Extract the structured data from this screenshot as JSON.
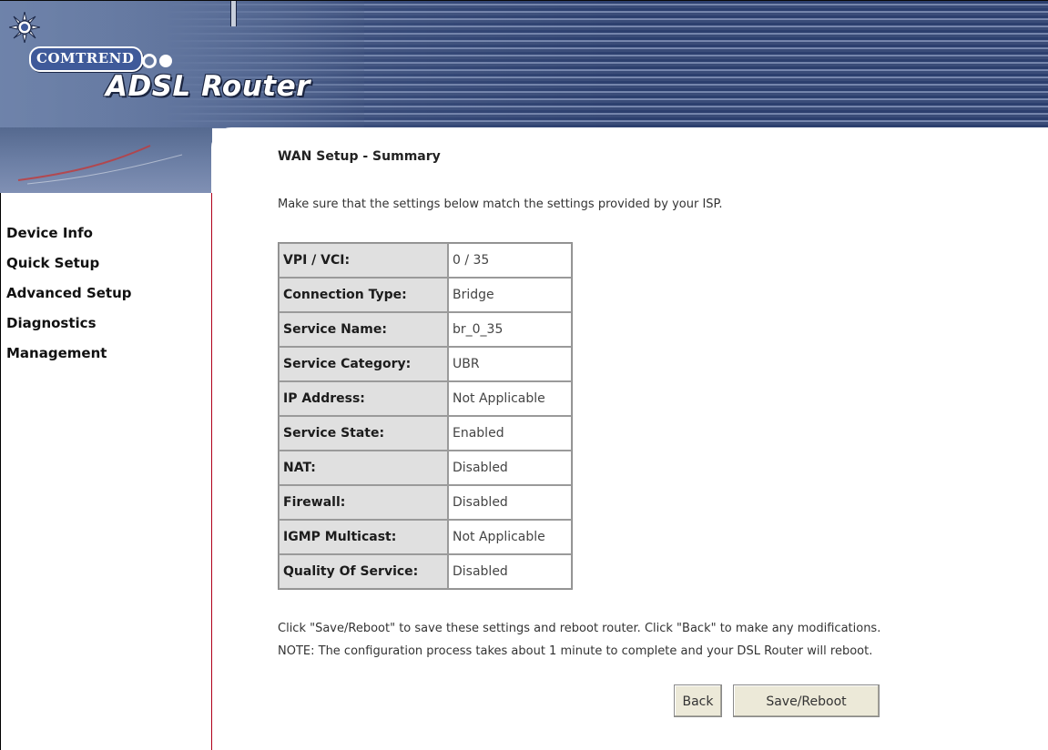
{
  "brand": {
    "company": "COMTREND",
    "product": "ADSL Router"
  },
  "sidebar": {
    "items": [
      {
        "label": "Device Info"
      },
      {
        "label": "Quick Setup"
      },
      {
        "label": "Advanced Setup"
      },
      {
        "label": "Diagnostics"
      },
      {
        "label": "Management"
      }
    ]
  },
  "main": {
    "title": "WAN Setup - Summary",
    "intro": "Make sure that the settings below match the settings provided by your ISP.",
    "summary_rows": [
      {
        "label": "VPI / VCI:",
        "value": "0 / 35"
      },
      {
        "label": "Connection Type:",
        "value": "Bridge"
      },
      {
        "label": "Service Name:",
        "value": "br_0_35"
      },
      {
        "label": "Service Category:",
        "value": "UBR"
      },
      {
        "label": "IP Address:",
        "value": "Not Applicable"
      },
      {
        "label": "Service State:",
        "value": "Enabled"
      },
      {
        "label": "NAT:",
        "value": "Disabled"
      },
      {
        "label": "Firewall:",
        "value": "Disabled"
      },
      {
        "label": "IGMP Multicast:",
        "value": "Not Applicable"
      },
      {
        "label": "Quality Of Service:",
        "value": "Disabled"
      }
    ],
    "note_line1": "Click \"Save/Reboot\" to save these settings and reboot router. Click \"Back\" to make any modifications.",
    "note_line2": "NOTE: The configuration process takes about 1 minute to complete and your DSL Router will reboot.",
    "buttons": {
      "back": "Back",
      "save_reboot": "Save/Reboot"
    }
  },
  "colors": {
    "banner": "#3a4c78",
    "sidebar_border": "#b0001a",
    "label_cell_bg": "#e0e0e0",
    "button_bg": "#ece9d8"
  },
  "icons": [
    "comtrend-sun-logo-icon"
  ]
}
